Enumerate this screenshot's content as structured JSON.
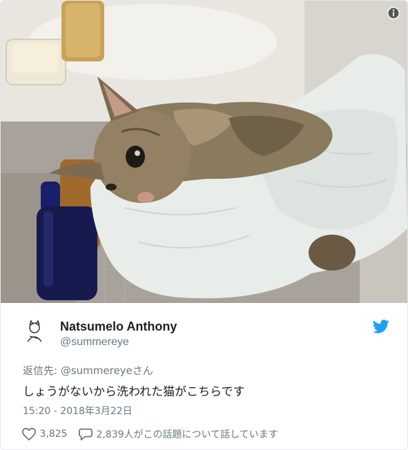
{
  "tweet": {
    "image_alt": "",
    "author_name": "Natsumelo Anthony",
    "author_handle": "@summereye",
    "reply_prefix": "返信先:",
    "reply_mention": "@summereye",
    "reply_suffix": "さん",
    "text": "しょうがないから洗われた猫がこちらです",
    "timestamp": "15:20 - 2018年3月22日",
    "likes": "3,825",
    "replies_text": "2,839人がこの話題について話しています"
  },
  "colors": {
    "accent": "#1da1f2",
    "text_primary": "#1c2022",
    "text_secondary": "#697882",
    "border": "#e1e8ed"
  },
  "icons": {
    "info": "info-icon",
    "bird": "twitter-bird-icon",
    "heart": "heart-icon",
    "reply": "reply-bubble-icon"
  }
}
